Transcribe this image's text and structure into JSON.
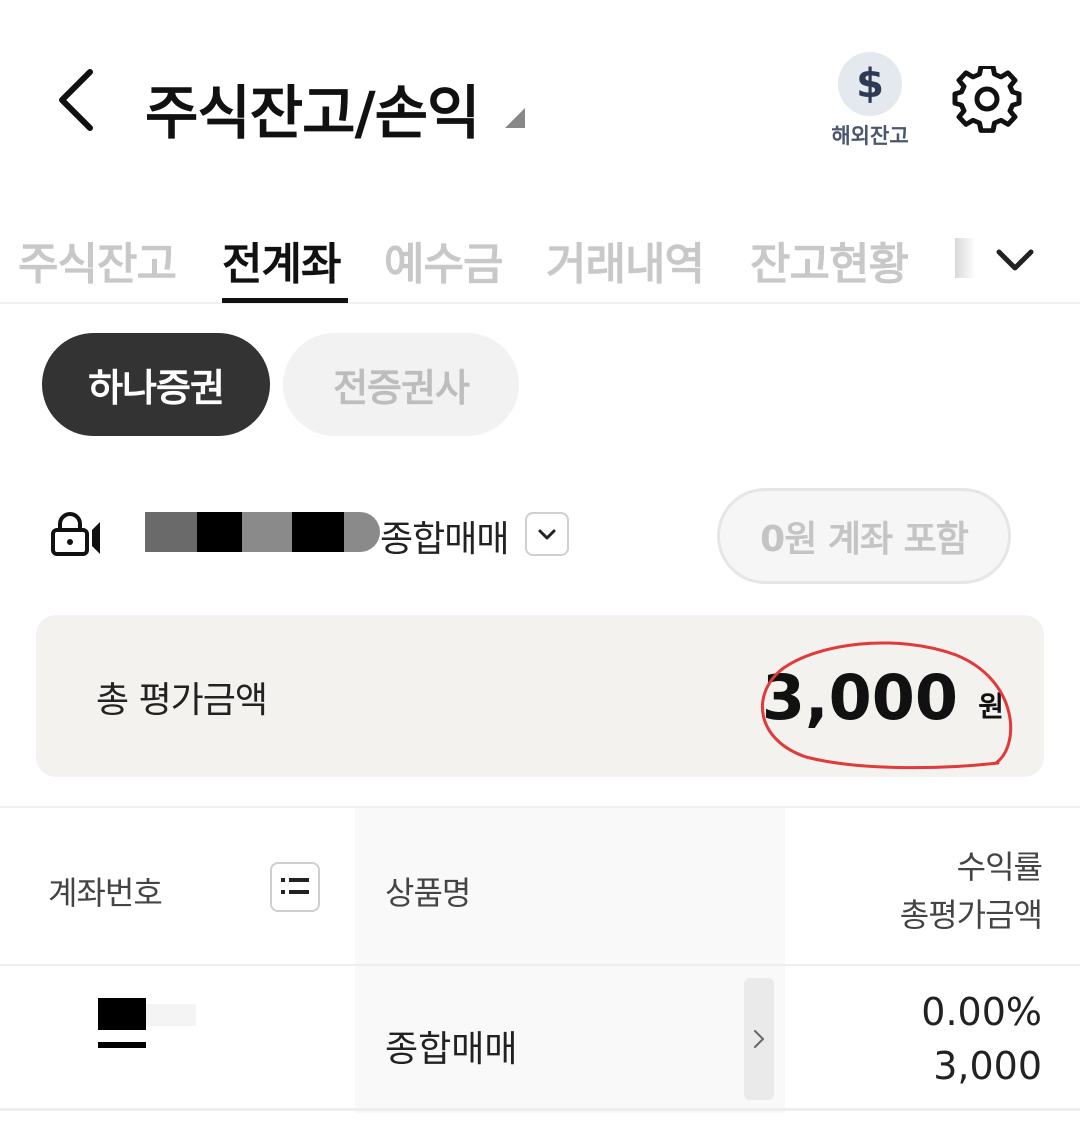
{
  "header": {
    "title": "주식잔고/손익",
    "overseas_label": "해외잔고",
    "overseas_symbol": "$"
  },
  "tabs": [
    {
      "label": "주식잔고",
      "active": false
    },
    {
      "label": "전계좌",
      "active": true
    },
    {
      "label": "예수금",
      "active": false
    },
    {
      "label": "거래내역",
      "active": false
    },
    {
      "label": "잔고현황",
      "active": false
    }
  ],
  "brokers": {
    "hana": "하나증권",
    "all": "전증권사"
  },
  "account": {
    "type": "종합매매",
    "zero_include_label": "0원 계좌 포함"
  },
  "total": {
    "label": "총 평가금액",
    "value": "3,000",
    "unit": "원"
  },
  "table": {
    "headers": {
      "account_no": "계좌번호",
      "product": "상품명",
      "return_rate": "수익률",
      "total_eval": "총평가금액"
    },
    "rows": [
      {
        "product": "종합매매",
        "return_rate": "0.00%",
        "total_eval": "3,000"
      }
    ]
  },
  "colors": {
    "active_chip": "#333333",
    "total_card_bg": "#f3f2ee",
    "annotation_circle": "#e03a3a"
  }
}
